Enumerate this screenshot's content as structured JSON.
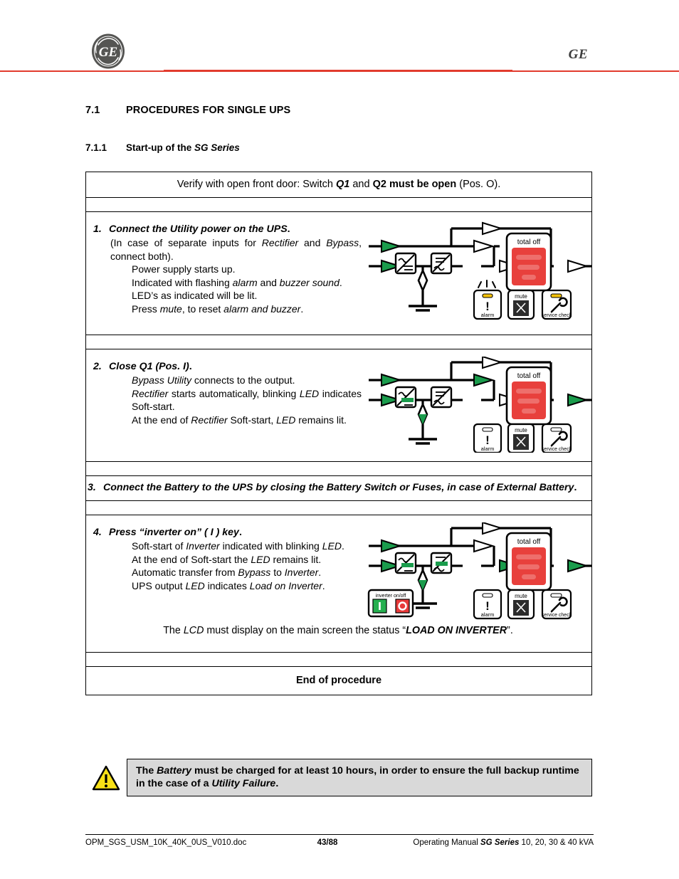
{
  "header": {
    "logo_icon": "ge-logo-icon",
    "wordmark": "GE",
    "rule_color": "#e23b2e"
  },
  "headings": {
    "section_number": "7.1",
    "section_title": "PROCEDURES FOR SINGLE UPS",
    "subsection_number": "7.1.1",
    "subsection_title_plain": "Start-up of the ",
    "subsection_title_italic": "SG Series"
  },
  "procedure": {
    "verify_row": {
      "t1": "Verify with open front door: Switch ",
      "q1": "Q1",
      "t2": " and ",
      "q2": "Q2 must be open",
      "t3": " (Pos. O)."
    },
    "step1": {
      "number": "1.",
      "title": "Connect the Utility power on the UPS",
      "title_period": ".",
      "lines": [
        "(In case of separate inputs for Rectifier and Bypass, connect both).",
        "Power supply starts up.",
        "Indicated with flashing alarm and buzzer sound.",
        "LED's as indicated will be lit.",
        "Press mute, to reset alarm and buzzer."
      ]
    },
    "step2": {
      "number": "2.",
      "title": "Close Q1 (Pos. I)",
      "title_period": ".",
      "lines": [
        "Bypass Utility connects to the output.",
        "Rectifier starts automatically, blinking LED indicates Soft-start.",
        "At the end of Rectifier Soft-start, LED remains lit."
      ]
    },
    "step3": {
      "number": "3.",
      "text": "Connect the Battery to the UPS by closing the Battery Switch or Fuses, in case of External Battery",
      "period": "."
    },
    "step4": {
      "number": "4.",
      "title_a": "Press ",
      "title_quoted": "“inverter on” ( I ) key",
      "title_period": ".",
      "lines": [
        "Soft-start of Inverter indicated with blinking LED.",
        "At the end of Soft-start the LED remains lit.",
        "Automatic transfer from Bypass to Inverter.",
        "UPS output LED indicates Load on Inverter."
      ]
    },
    "lcd_row": {
      "t1": "The ",
      "lcd": "LCD",
      "t2": " must display on the main screen the status ",
      "quote_open": "“",
      "status": "LOAD ON INVERTER",
      "quote_close": "”",
      "t3": "."
    },
    "end_row": "End of procedure"
  },
  "diagram_labels": {
    "total_off": "total off",
    "alarm": "alarm",
    "mute": "mute",
    "service_check": "service check",
    "inverter_onoff": "inverter on/off",
    "inverter_on_key": "I",
    "inverter_off_key": "O"
  },
  "diagram_colors": {
    "active_green": "#1a9c4c",
    "panel_red": "#e8403c",
    "led_yellow": "#f5c20a",
    "off_white": "#ffffff",
    "line_black": "#000000"
  },
  "warning": {
    "icon": "warning-triangle-icon",
    "t1": "The ",
    "battery": "Battery",
    "t2": " must be charged for at least 10 hours, in order to ensure the full backup runtime in the case of a ",
    "utility_failure": "Utility Failure",
    "t3": "."
  },
  "footer": {
    "file_name": "OPM_SGS_USM_10K_40K_0US_V010.doc",
    "page": "43/88",
    "manual_t1": "Operating Manual ",
    "manual_series": "SG Series",
    "manual_t2": " 10, 20, 30 & 40 kVA"
  }
}
